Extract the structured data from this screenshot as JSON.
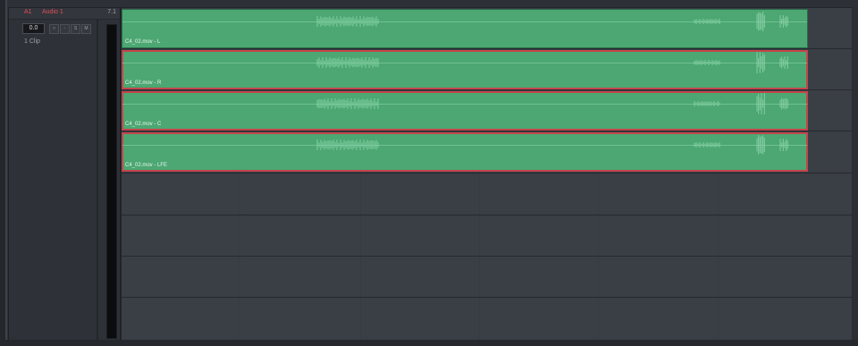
{
  "track": {
    "id": "A1",
    "name": "Audio 1",
    "format": "7.1",
    "level": "0.0",
    "clip_count": "1 Clip",
    "buttons": [
      {
        "label": "",
        "name": "lock-button"
      },
      {
        "label": "",
        "name": "auto-select-button"
      },
      {
        "label": "S",
        "name": "solo-button"
      },
      {
        "label": "M",
        "name": "mute-button"
      }
    ]
  },
  "clips": [
    {
      "label": "C4_02.mov - L",
      "selected": false
    },
    {
      "label": "C4_02.mov - R",
      "selected": true
    },
    {
      "label": "C4_02.mov - C",
      "selected": true
    },
    {
      "label": "C4_02.mov - LFE",
      "selected": true
    }
  ],
  "colors": {
    "clip_fill": "#4ca772",
    "selection_outline": "#c4454b",
    "track_label": "#e0505a"
  }
}
